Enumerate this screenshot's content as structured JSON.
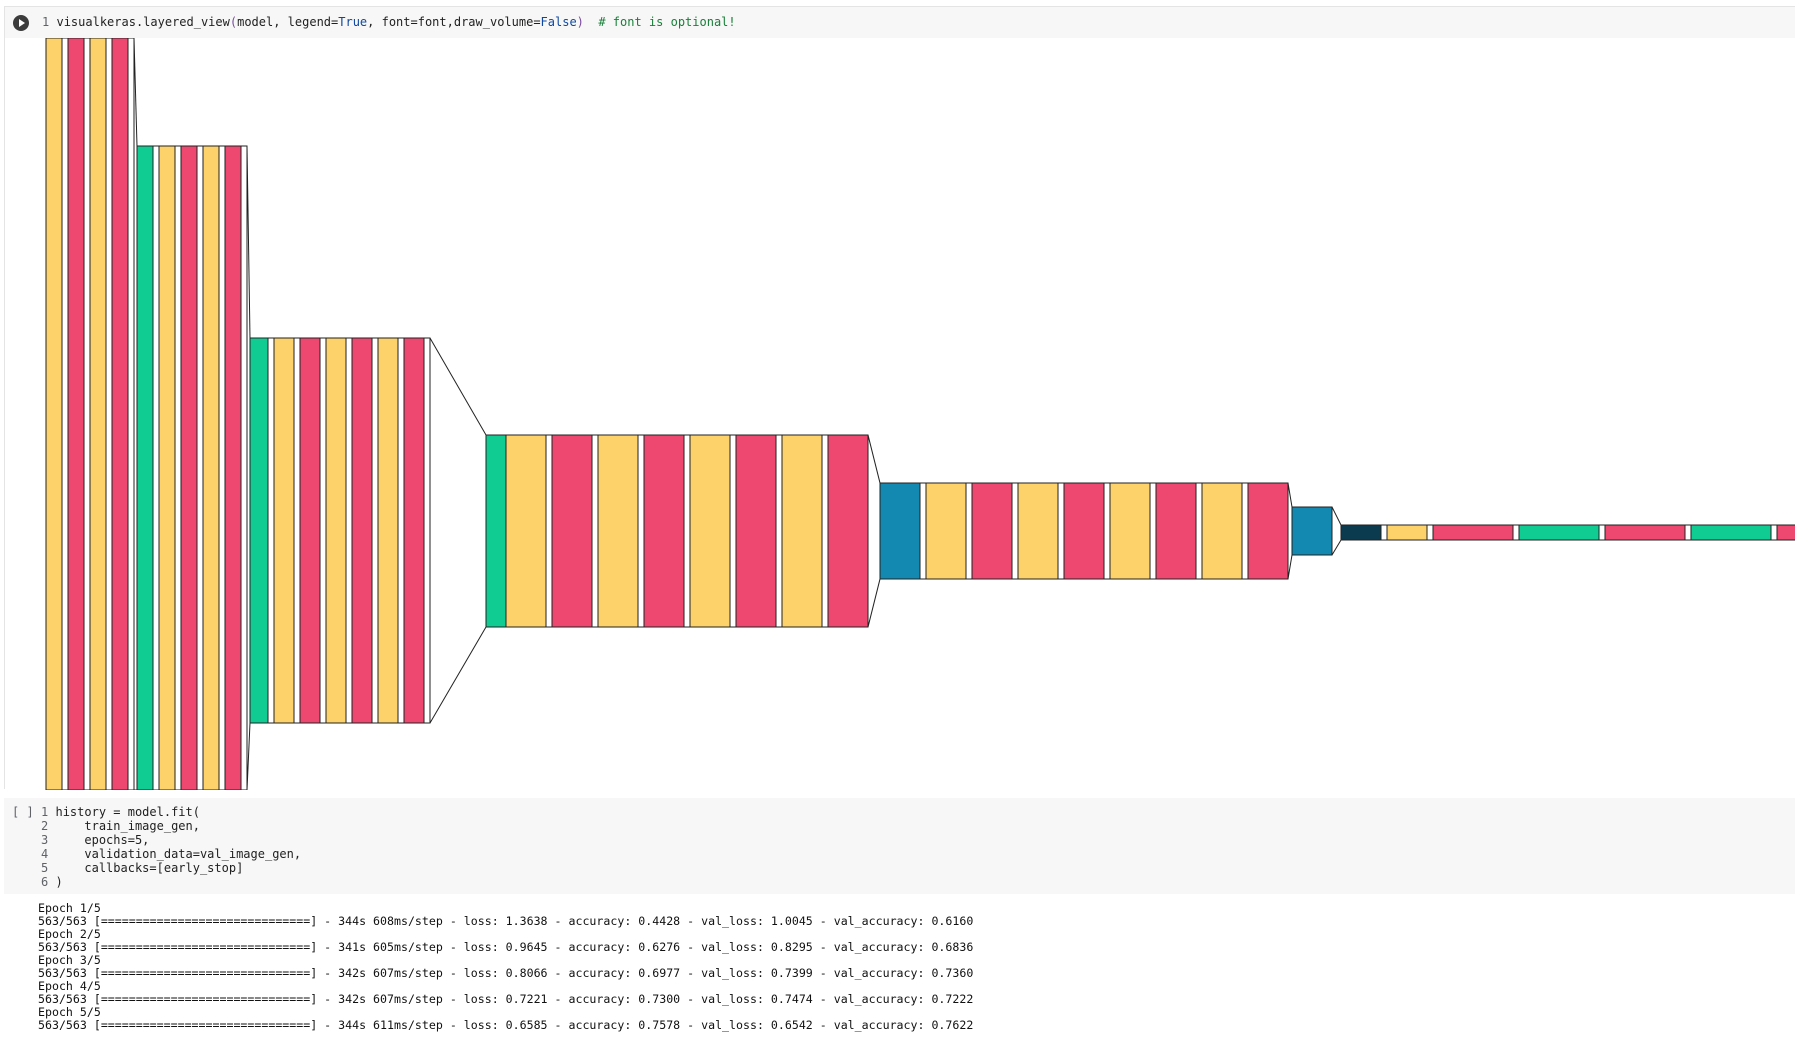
{
  "cell1": {
    "line_number": "1",
    "code_prefix": "visualkeras.layered_view",
    "code_args_a": "model, legend=",
    "true_kw": "True",
    "code_args_b": ", font=font,draw_volume=",
    "false_kw": "False",
    "comment": "# font is optional!",
    "run_icon": "play-icon",
    "output_icon": "output-toggle-icon"
  },
  "cell2": {
    "bracket": "[ ]",
    "lines": [
      {
        "n": "1",
        "text": "history = model.fit("
      },
      {
        "n": "2",
        "text": "    train_image_gen,"
      },
      {
        "n": "3",
        "text": "    epochs=5,"
      },
      {
        "n": "4",
        "text": "    validation_data=val_image_gen,"
      },
      {
        "n": "5",
        "text": "    callbacks=[early_stop]"
      },
      {
        "n": "6",
        "text": ")"
      }
    ]
  },
  "training_output": [
    "Epoch 1/5",
    "563/563 [==============================] - 344s 608ms/step - loss: 1.3638 - accuracy: 0.4428 - val_loss: 1.0045 - val_accuracy: 0.6160",
    "Epoch 2/5",
    "563/563 [==============================] - 341s 605ms/step - loss: 0.9645 - accuracy: 0.6276 - val_loss: 0.8295 - val_accuracy: 0.6836",
    "Epoch 3/5",
    "563/563 [==============================] - 342s 607ms/step - loss: 0.8066 - accuracy: 0.6977 - val_loss: 0.7399 - val_accuracy: 0.7360",
    "Epoch 4/5",
    "563/563 [==============================] - 342s 607ms/step - loss: 0.7221 - accuracy: 0.7300 - val_loss: 0.7474 - val_accuracy: 0.7222",
    "Epoch 5/5",
    "563/563 [==============================] - 344s 611ms/step - loss: 0.6585 - accuracy: 0.7578 - val_loss: 0.6542 - val_accuracy: 0.7622"
  ],
  "colors": {
    "conv": "#fdd26a",
    "pool": "#ee4870",
    "bn": "#10cc92",
    "relu": "#ffffff",
    "dense_blue": "#1389b1",
    "dark": "#0b3b4f"
  },
  "layer_sequence": [
    "conv",
    "relu",
    "pool",
    "relu",
    "conv",
    "relu",
    "pool",
    "relu",
    "bn",
    "relu",
    "conv",
    "relu",
    "pool",
    "relu",
    "conv",
    "relu",
    "pool",
    "relu",
    "bn",
    "relu",
    "conv",
    "relu",
    "pool",
    "relu",
    "conv",
    "relu",
    "pool",
    "relu",
    "conv",
    "relu",
    "pool",
    "relu",
    "bn",
    "conv",
    "relu",
    "pool",
    "relu",
    "conv",
    "relu",
    "pool",
    "relu",
    "conv",
    "relu",
    "pool",
    "relu",
    "conv",
    "relu",
    "pool",
    "dense_blue",
    "relu",
    "conv",
    "relu",
    "pool",
    "relu",
    "conv",
    "relu",
    "pool",
    "relu",
    "conv",
    "relu",
    "pool",
    "relu",
    "conv",
    "relu",
    "pool",
    "dense_blue",
    "dark",
    "relu",
    "conv",
    "relu",
    "pool",
    "relu",
    "bn",
    "relu",
    "pool",
    "relu",
    "bn",
    "relu",
    "pool"
  ]
}
